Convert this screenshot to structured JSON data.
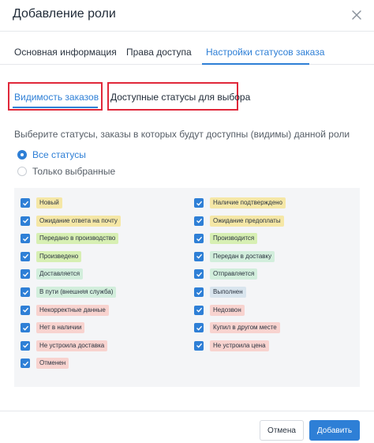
{
  "dialog": {
    "title": "Добавление роли"
  },
  "tabs": [
    {
      "label": "Основная информация",
      "active": false
    },
    {
      "label": "Права доступа",
      "active": false
    },
    {
      "label": "Настройки статусов заказа",
      "active": true
    }
  ],
  "subtabs": [
    {
      "label": "Видимость заказов",
      "active": true
    },
    {
      "label": "Доступные статусы для выбора",
      "active": false
    }
  ],
  "visibility": {
    "description": "Выберите статусы, заказы в которых будут доступны (видимы) данной роли",
    "options": [
      {
        "label": "Все статусы",
        "checked": true
      },
      {
        "label": "Только выбранные",
        "checked": false
      }
    ]
  },
  "statuses": {
    "left": [
      {
        "label": "Новый",
        "color": "#f5e7a6",
        "checked": true
      },
      {
        "label": "Ожидание ответа на почту",
        "color": "#f5e7a6",
        "checked": true
      },
      {
        "label": "Передано в производство",
        "color": "#d7efb3",
        "checked": true
      },
      {
        "label": "Произведено",
        "color": "#d7efb3",
        "checked": true
      },
      {
        "label": "Доставляется",
        "color": "#d2eedc",
        "checked": true
      },
      {
        "label": "В пути (внешняя служба)",
        "color": "#d2eedc",
        "checked": true
      },
      {
        "label": "Некорректные данные",
        "color": "#f8d3cf",
        "checked": true
      },
      {
        "label": "Нет в наличии",
        "color": "#f8d3cf",
        "checked": true
      },
      {
        "label": "Не устроила доставка",
        "color": "#f8d3cf",
        "checked": true
      },
      {
        "label": "Отменен",
        "color": "#f8d3cf",
        "checked": true
      }
    ],
    "right": [
      {
        "label": "Наличие подтверждено",
        "color": "#f5e7a6",
        "checked": true
      },
      {
        "label": "Ожидание предоплаты",
        "color": "#f5e7a6",
        "checked": true
      },
      {
        "label": "Производится",
        "color": "#d7efb3",
        "checked": true
      },
      {
        "label": "Передан в доставку",
        "color": "#d2eedc",
        "checked": true
      },
      {
        "label": "Отправляется",
        "color": "#d2eedc",
        "checked": true
      },
      {
        "label": "Выполнен",
        "color": "#d9e5ee",
        "checked": true
      },
      {
        "label": "Недозвон",
        "color": "#f8d3cf",
        "checked": true
      },
      {
        "label": "Купил в другом месте",
        "color": "#f8d3cf",
        "checked": true
      },
      {
        "label": "Не устроила цена",
        "color": "#f8d3cf",
        "checked": true
      }
    ]
  },
  "footer": {
    "cancel_label": "Отмена",
    "add_label": "Добавить"
  },
  "colors": {
    "accent": "#2e7fd6",
    "highlight_border": "#e0283a"
  },
  "icons": {
    "close": "close-icon",
    "checkbox": "check-icon"
  }
}
